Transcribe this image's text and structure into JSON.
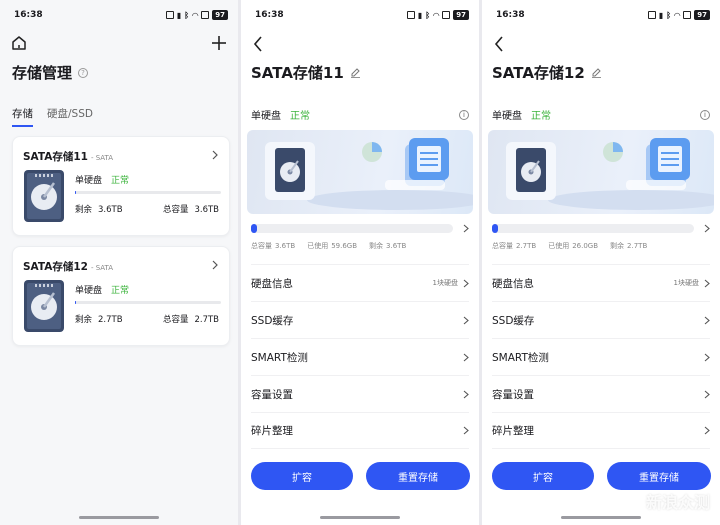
{
  "status": {
    "time": "16:38",
    "battery": "97"
  },
  "list_screen": {
    "title": "存储管理",
    "tabs": [
      "存储",
      "硬盘/SSD"
    ],
    "cards": [
      {
        "name": "SATA存储11",
        "sub": "- SATA",
        "type": "单硬盘",
        "state": "正常",
        "remaining_label": "剩余",
        "remaining": "3.6TB",
        "total_label": "总容量",
        "total": "3.6TB"
      },
      {
        "name": "SATA存储12",
        "sub": "- SATA",
        "type": "单硬盘",
        "state": "正常",
        "remaining_label": "剩余",
        "remaining": "2.7TB",
        "total_label": "总容量",
        "total": "2.7TB"
      }
    ]
  },
  "detail_screens": [
    {
      "title": "SATA存储11",
      "type": "单硬盘",
      "state": "正常",
      "usage_fraction": 0.03,
      "stats": {
        "total_label": "总容量",
        "total": "3.6TB",
        "used_label": "已使用",
        "used": "59.6GB",
        "remaining_label": "剩余",
        "remaining": "3.6TB"
      },
      "menu": [
        {
          "label": "硬盘信息",
          "value": "1块硬盘"
        },
        {
          "label": "SSD缓存",
          "value": ""
        },
        {
          "label": "SMART检测",
          "value": ""
        },
        {
          "label": "容量设置",
          "value": ""
        },
        {
          "label": "碎片整理",
          "value": ""
        }
      ],
      "buttons": {
        "expand": "扩容",
        "reset": "重置存储"
      }
    },
    {
      "title": "SATA存储12",
      "type": "单硬盘",
      "state": "正常",
      "usage_fraction": 0.03,
      "stats": {
        "total_label": "总容量",
        "total": "2.7TB",
        "used_label": "已使用",
        "used": "26.0GB",
        "remaining_label": "剩余",
        "remaining": "2.7TB"
      },
      "menu": [
        {
          "label": "硬盘信息",
          "value": "1块硬盘"
        },
        {
          "label": "SSD缓存",
          "value": ""
        },
        {
          "label": "SMART检测",
          "value": ""
        },
        {
          "label": "容量设置",
          "value": ""
        },
        {
          "label": "碎片整理",
          "value": ""
        }
      ],
      "buttons": {
        "expand": "扩容",
        "reset": "重置存储"
      }
    }
  ],
  "watermark": "新浪众测",
  "colors": {
    "accent": "#2f56f3",
    "ok": "#3ab33a"
  }
}
